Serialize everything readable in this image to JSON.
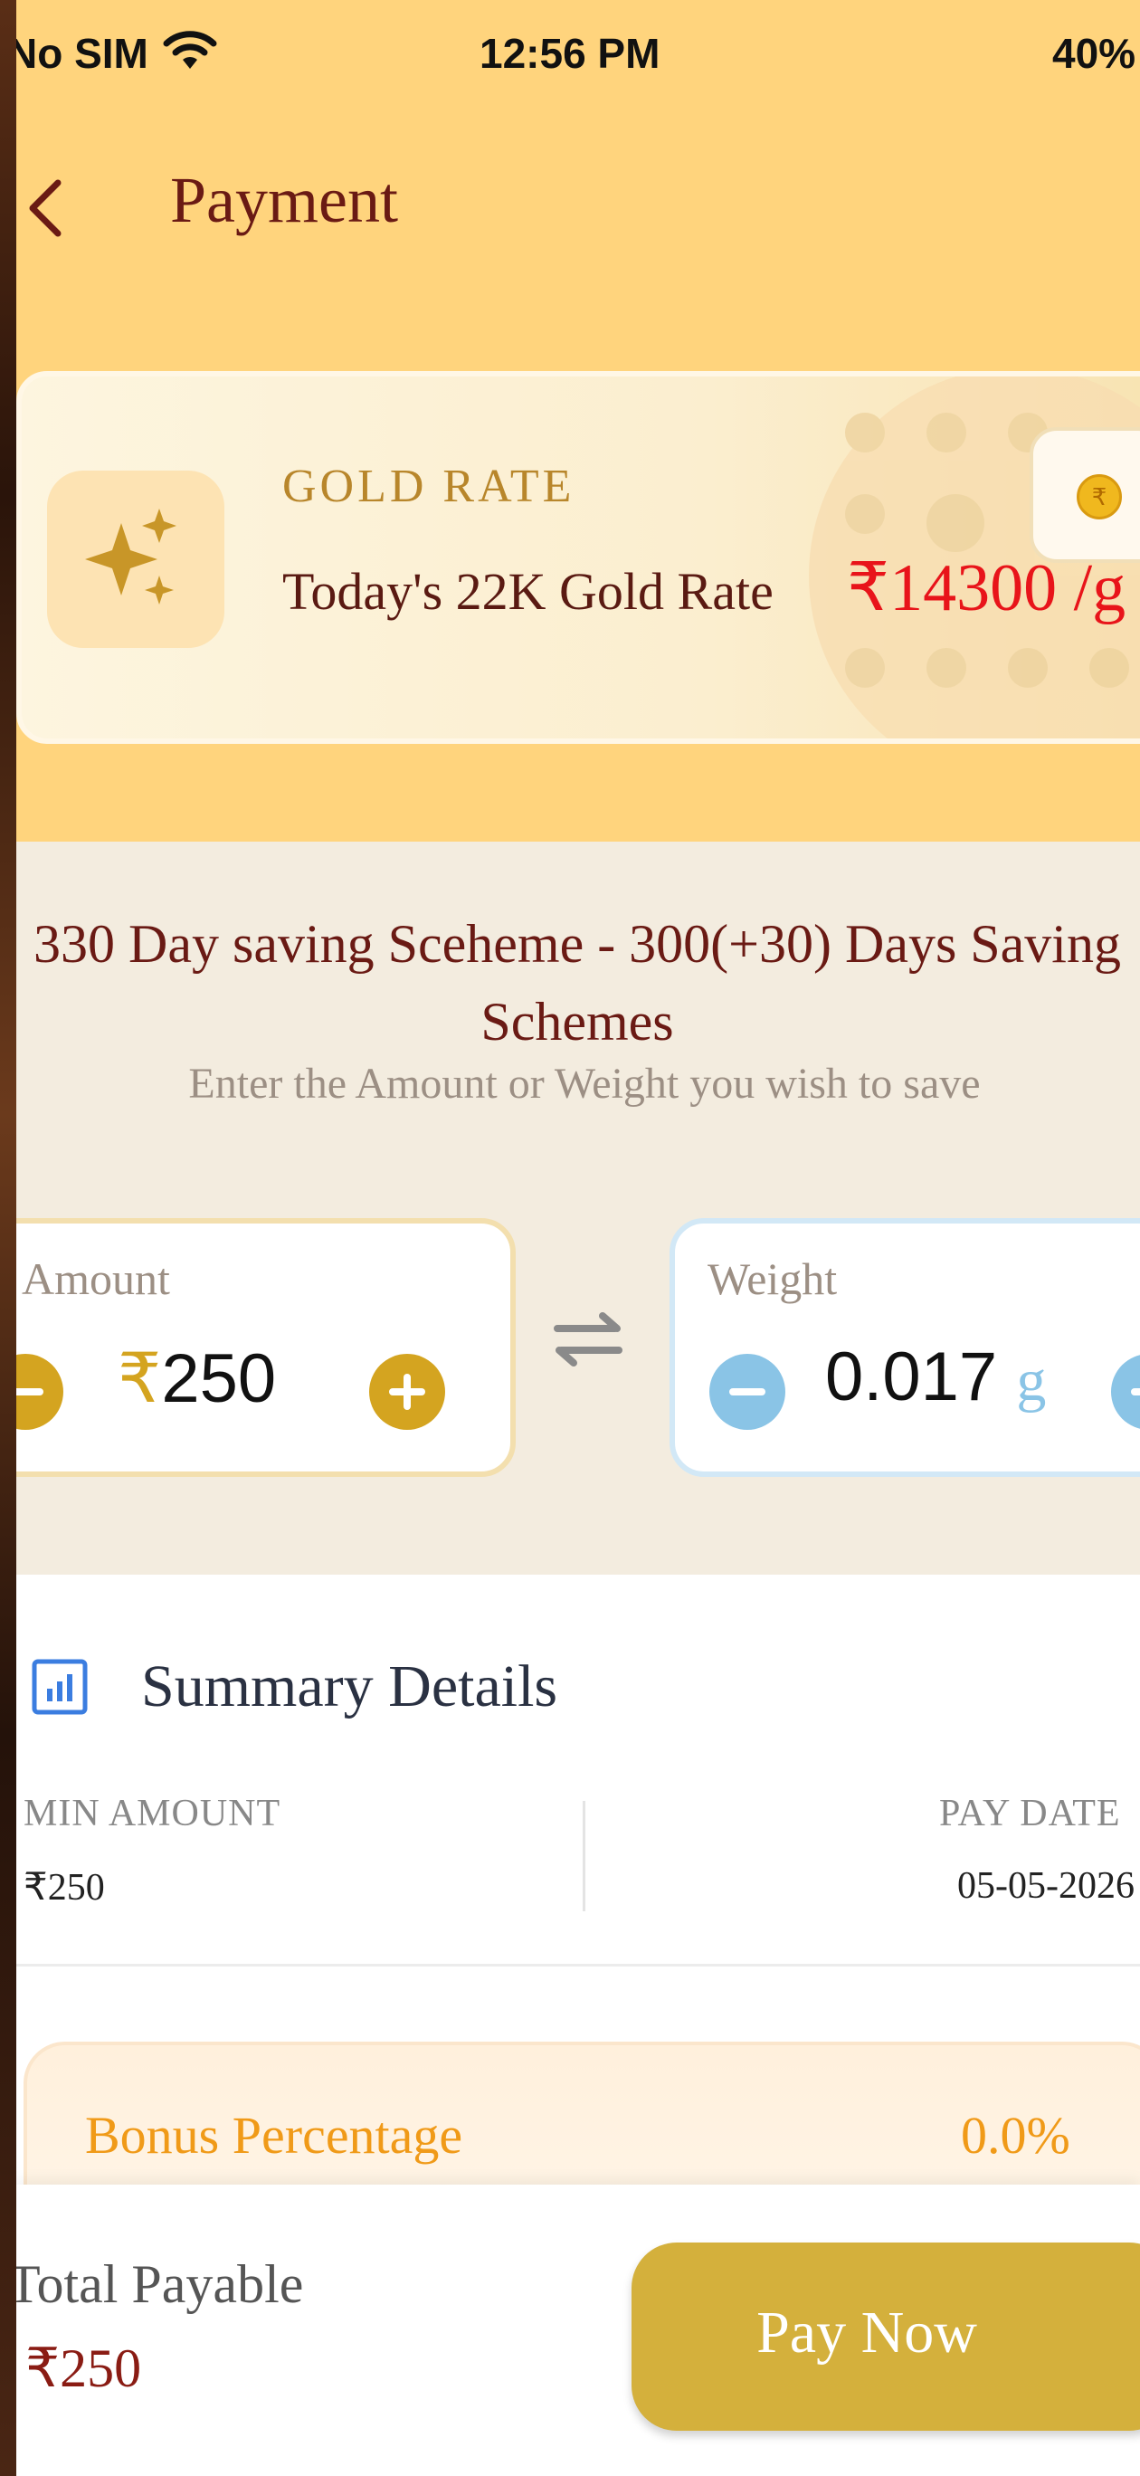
{
  "status_bar": {
    "carrier": "No SIM",
    "time": "12:56 PM",
    "battery": "40%"
  },
  "header": {
    "title": "Payment"
  },
  "gold_rate": {
    "label": "GOLD RATE",
    "description": "Today's 22K Gold Rate",
    "value": "₹14300 /g",
    "coin_symbol": "₹"
  },
  "scheme": {
    "title": "330 Day saving Sceheme - 300(+30) Days Saving Schemes",
    "subtitle": "Enter the Amount or Weight you wish to save"
  },
  "amount": {
    "label": "Amount",
    "currency": "₹",
    "value": "250"
  },
  "weight": {
    "label": "Weight",
    "value": "0.017",
    "unit": "g"
  },
  "summary": {
    "title": "Summary Details",
    "min_amount_label": "MIN AMOUNT",
    "min_amount_value": "₹250",
    "pay_date_label": "PAY DATE",
    "pay_date_value": "05-05-2026"
  },
  "bonus": {
    "label": "Bonus Percentage",
    "value": "0.0%"
  },
  "footer": {
    "total_label": "Total Payable",
    "total_value": "₹250",
    "pay_button": "Pay Now"
  },
  "colors": {
    "header_bg": "#ffd47d",
    "accent_gold": "#d4b03c",
    "rate_red": "#e8141a",
    "title_maroon": "#6a1a14",
    "bonus_orange": "#f09a18"
  }
}
